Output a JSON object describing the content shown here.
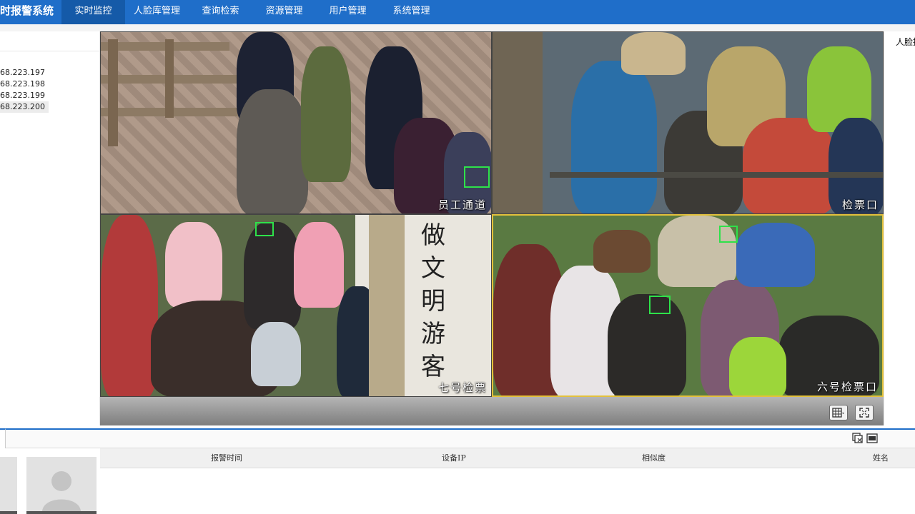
{
  "app": {
    "title": "时报警系统"
  },
  "nav": {
    "items": [
      {
        "label": "实时监控",
        "active": true
      },
      {
        "label": "人脸库管理",
        "active": false
      },
      {
        "label": "查询检索",
        "active": false
      },
      {
        "label": "资源管理",
        "active": false
      },
      {
        "label": "用户管理",
        "active": false
      },
      {
        "label": "系统管理",
        "active": false
      }
    ]
  },
  "devices": {
    "items": [
      {
        "label": "68.223.197",
        "selected": false
      },
      {
        "label": "68.223.198",
        "selected": false
      },
      {
        "label": "68.223.199",
        "selected": false
      },
      {
        "label": "68.223.200",
        "selected": true
      }
    ]
  },
  "cameras": [
    {
      "label": "员工通道",
      "selected": false
    },
    {
      "label": "检票口",
      "selected": false
    },
    {
      "label": "七号检票",
      "selected": false
    },
    {
      "label": "六号检票口",
      "selected": true
    }
  ],
  "signboard": {
    "text": "做文明游客"
  },
  "right_panel": {
    "title": "人脸抓拍"
  },
  "video_controls": {
    "layout_icon": "grid-layout-icon",
    "fullscreen_icon": "fullscreen-icon"
  },
  "alarm_table": {
    "columns": [
      "报警时间",
      "设备IP",
      "相似度",
      "姓名"
    ],
    "rows": []
  },
  "colors": {
    "nav_bg": "#1f6ec9",
    "nav_active": "#155aa8",
    "face_box": "#2ee24a",
    "selected_tile": "#e3c13c"
  }
}
